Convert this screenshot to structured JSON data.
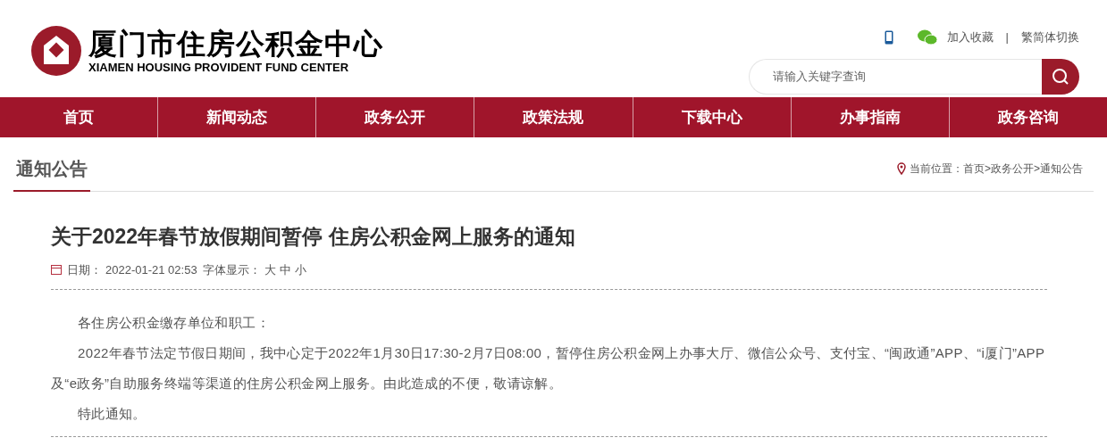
{
  "header": {
    "title": "厦门市住房公积金中心",
    "subtitle": "XIAMEN HOUSING PROVIDENT FUND CENTER",
    "links": [
      "加入收藏",
      "|",
      "繁简体切换"
    ],
    "search": {
      "placeholder": "请输入关键字查询"
    }
  },
  "nav": [
    "首页",
    "新闻动态",
    "政务公开",
    "政策法规",
    "下载中心",
    "办事指南",
    "政务咨询"
  ],
  "section": {
    "title": "通知公告",
    "breadcrumb_label": "当前位置：",
    "breadcrumb": [
      "首页",
      ">",
      "政务公开",
      ">",
      "通知公告"
    ]
  },
  "article": {
    "title": "关于2022年春节放假期间暂停 住房公积金网上服务的通知",
    "date_label": "日期：",
    "date": "2022-01-21 02:53",
    "font_size_label": "字体显示：",
    "font_sizes": [
      "大",
      "中",
      "小"
    ],
    "paragraphs": [
      "各住房公积金缴存单位和职工：",
      "2022年春节法定节假日期间，我中心定于2022年1月30日17:30-2月7日08:00，暂停住房公积金网上办事大厅、微信公众号、支付宝、“闽政通”APP、“i厦门”APP及“e政务”自助服务终端等渠道的住房公积金网上服务。由此造成的不便，敬请谅解。",
      "特此通知。"
    ]
  }
}
